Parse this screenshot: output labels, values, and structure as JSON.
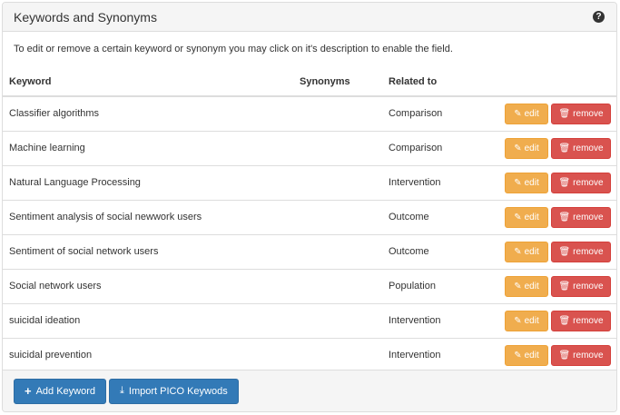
{
  "panel": {
    "title": "Keywords and Synonyms",
    "help_icon": "question-circle-icon",
    "instructions": "To edit or remove a certain keyword or synonym you may click on it's description to enable the field."
  },
  "table": {
    "headers": {
      "keyword": "Keyword",
      "synonyms": "Synonyms",
      "related_to": "Related to"
    },
    "rows": [
      {
        "keyword": "Classifier algorithms",
        "synonyms": "",
        "related_to": "Comparison",
        "edit_label": "edit",
        "remove_label": "remove"
      },
      {
        "keyword": "Machine learning",
        "synonyms": "",
        "related_to": "Comparison",
        "edit_label": "edit",
        "remove_label": "remove"
      },
      {
        "keyword": "Natural Language Processing",
        "synonyms": "",
        "related_to": "Intervention",
        "edit_label": "edit",
        "remove_label": "remove"
      },
      {
        "keyword": "Sentiment analysis of social newwork users",
        "synonyms": "",
        "related_to": "Outcome",
        "edit_label": "edit",
        "remove_label": "remove"
      },
      {
        "keyword": "Sentiment of social network users",
        "synonyms": "",
        "related_to": "Outcome",
        "edit_label": "edit",
        "remove_label": "remove"
      },
      {
        "keyword": "Social network users",
        "synonyms": "",
        "related_to": "Population",
        "edit_label": "edit",
        "remove_label": "remove"
      },
      {
        "keyword": "suicidal ideation",
        "synonyms": "",
        "related_to": "Intervention",
        "edit_label": "edit",
        "remove_label": "remove"
      },
      {
        "keyword": "suicidal prevention",
        "synonyms": "",
        "related_to": "Intervention",
        "edit_label": "edit",
        "remove_label": "remove"
      }
    ]
  },
  "footer": {
    "add_keyword_label": "Add Keyword",
    "import_label": "Import PICO Keywods"
  },
  "icons": {
    "edit": "pencil-icon",
    "remove": "trash-icon",
    "add": "plus-icon",
    "import": "import-icon"
  },
  "colors": {
    "edit_button": "#f0ad4e",
    "remove_button": "#d9534f",
    "primary_button": "#337ab7",
    "panel_heading": "#f5f5f5"
  }
}
